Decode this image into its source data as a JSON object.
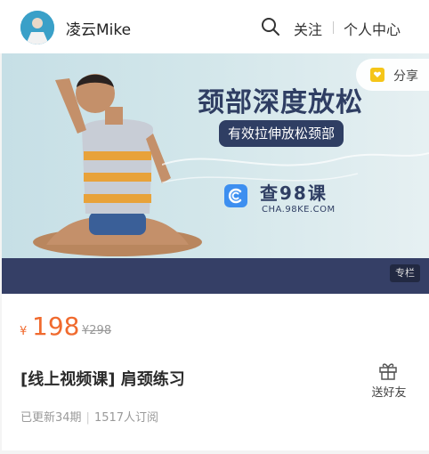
{
  "header": {
    "username": "凌云Mike",
    "nav_follow": "关注",
    "nav_center": "个人中心",
    "icons": {
      "search": "search-icon",
      "avatar": "avatar"
    }
  },
  "banner": {
    "title": "颈部深度放松",
    "subtitle": "有效拉伸放松颈部",
    "brand_name": "查98课",
    "brand_url": "CHA.98KE.COM",
    "share_label": "分享",
    "column_badge": "专栏",
    "colors": {
      "navy": "#2f3e63",
      "strip": "#353f66",
      "brand_blue": "#3d8ff0",
      "share_yellow": "#f5c518"
    }
  },
  "product": {
    "currency": "¥",
    "price": "198",
    "original_price": "¥298",
    "title": "[线上视频课] 肩颈练习",
    "gift_label": "送好友",
    "updated": "已更新34期",
    "subscribers": "1517人订阅",
    "colors": {
      "price": "#f06a2e"
    }
  }
}
